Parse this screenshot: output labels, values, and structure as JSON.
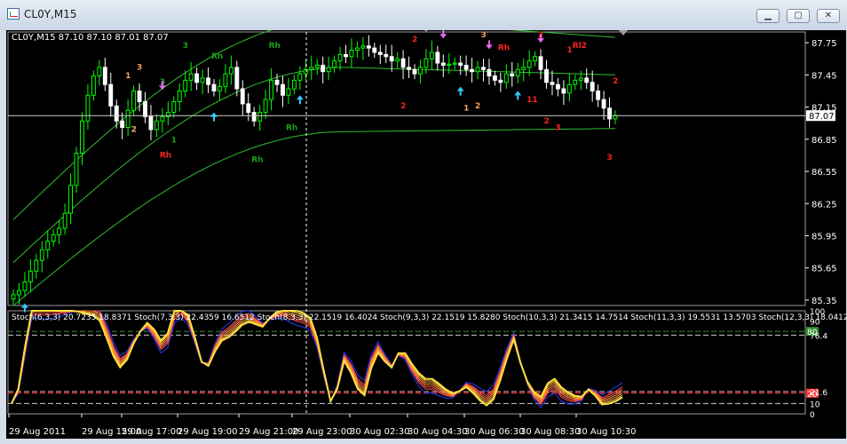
{
  "window": {
    "title": "CL0Y,M15",
    "min_label": "▁",
    "max_label": "▢",
    "close_label": "✕"
  },
  "chart_data": [
    {
      "type": "candlestick",
      "symbol": "CL0Y",
      "timeframe": "M15",
      "info_label": "CL0Y,M15  87.10 87.10 87.01 87.07",
      "ohlc": {
        "open": 87.1,
        "high": 87.1,
        "low": 87.01,
        "close": 87.07
      },
      "current_price": 87.07,
      "current_price_label": "87.07",
      "y_ticks": [
        85.35,
        85.65,
        85.95,
        86.25,
        86.55,
        86.85,
        87.15,
        87.45,
        87.75
      ],
      "y_tick_labels": [
        "85.35",
        "85.65",
        "85.95",
        "86.25",
        "86.55",
        "86.85",
        "87.15",
        "87.45",
        "87.75"
      ],
      "ylim": [
        85.3,
        87.85
      ],
      "close_series": [
        85.4,
        85.44,
        85.52,
        85.62,
        85.72,
        85.82,
        85.9,
        85.96,
        86.02,
        86.16,
        86.42,
        86.72,
        87.02,
        87.26,
        87.44,
        87.52,
        87.36,
        87.16,
        87.02,
        86.96,
        87.12,
        87.3,
        87.2,
        87.06,
        86.94,
        87.02,
        87.06,
        87.1,
        87.2,
        87.3,
        87.4,
        87.46,
        87.38,
        87.42,
        87.36,
        87.3,
        87.34,
        87.46,
        87.52,
        87.32,
        87.18,
        87.1,
        87.02,
        87.1,
        87.22,
        87.4,
        87.36,
        87.26,
        87.32,
        87.4,
        87.46,
        87.5,
        87.52,
        87.54,
        87.48,
        87.52,
        87.58,
        87.64,
        87.62,
        87.68,
        87.7,
        87.72,
        87.7,
        87.66,
        87.64,
        87.62,
        87.58,
        87.6,
        87.52,
        87.5,
        87.46,
        87.52,
        87.6,
        87.66,
        87.56,
        87.54,
        87.55,
        87.56,
        87.54,
        87.5,
        87.48,
        87.52,
        87.5,
        87.44,
        87.4,
        87.38,
        87.46,
        87.44,
        87.5,
        87.52,
        87.58,
        87.62,
        87.5,
        87.38,
        87.36,
        87.32,
        87.28,
        87.36,
        87.4,
        87.42,
        87.38,
        87.3,
        87.22,
        87.14,
        87.04,
        87.07
      ],
      "bands": {
        "upper_start": 86.1,
        "upper_peak": 87.98,
        "upper_end": 87.8,
        "middle_start": 85.7,
        "middle_peak": 87.52,
        "middle_end": 87.45,
        "lower_start": 85.3,
        "lower_peak": 86.92,
        "lower_end": 86.95
      },
      "annotations": [
        {
          "text": "1",
          "color": "#f4a460"
        },
        {
          "text": "2",
          "color": "#1aa01a"
        },
        {
          "text": "3",
          "color": "#f4a460"
        },
        {
          "text": "2",
          "color": "#f4a460"
        },
        {
          "text": "3",
          "color": "#1aa01a"
        },
        {
          "text": "1",
          "color": "#1aa01a"
        },
        {
          "text": "3",
          "color": "#1aa01a"
        },
        {
          "text": "Rh",
          "color": "#ff2222"
        },
        {
          "text": "Rh",
          "color": "#1aa01a"
        },
        {
          "text": "Rh",
          "color": "#1aa01a"
        },
        {
          "text": "Rh",
          "color": "#1aa01a"
        },
        {
          "text": "Rh",
          "color": "#1aa01a"
        },
        {
          "text": "1",
          "color": "#ff2222"
        },
        {
          "text": "2",
          "color": "#ff2222"
        },
        {
          "text": "2",
          "color": "#ff2222"
        },
        {
          "text": "1",
          "color": "#f4a460"
        },
        {
          "text": "3",
          "color": "#f4a460"
        },
        {
          "text": "2",
          "color": "#f4a460"
        },
        {
          "text": "Rh",
          "color": "#ff2222"
        },
        {
          "text": "11",
          "color": "#ff2222"
        },
        {
          "text": "2",
          "color": "#ff2222"
        },
        {
          "text": "3",
          "color": "#ff2222"
        },
        {
          "text": "1",
          "color": "#ff2222"
        },
        {
          "text": "2",
          "color": "#ff2222"
        },
        {
          "text": "Rl2",
          "color": "#ff2222"
        },
        {
          "text": "3",
          "color": "#ff2222"
        },
        {
          "text": "2",
          "color": "#ff2222"
        }
      ],
      "arrows": [
        {
          "direction": "up",
          "color": "#33ccff"
        },
        {
          "direction": "up",
          "color": "#33ccff"
        },
        {
          "direction": "up",
          "color": "#33ccff"
        },
        {
          "direction": "up",
          "color": "#33ccff"
        },
        {
          "direction": "up",
          "color": "#33ccff"
        },
        {
          "direction": "down",
          "color": "#ee66ee"
        },
        {
          "direction": "down",
          "color": "#ee66ee"
        },
        {
          "direction": "down",
          "color": "#ee66ee"
        },
        {
          "direction": "down",
          "color": "#ee66ee"
        },
        {
          "direction": "down",
          "color": "#ee66ee"
        },
        {
          "direction": "down",
          "color": "#ee66ee"
        }
      ],
      "colors": {
        "bull": "#00ff00",
        "bear": "#ffffff",
        "bands": "#2fbf2f",
        "axis_text": "#ffffff"
      }
    },
    {
      "type": "line",
      "title": "Stoch(6,3,3) 20.7235 18.8371  Stoch(7,3,3) 22.4359 16.6512  Stoch(8,3,3) 22.1519 16.4024  Stoch(9,3,3) 22.1519 15.8280  Stoch(10,3,3) 21.3415 14.7514  Stoch(11,3,3) 19.5531 13.5703  Stoch(12,3,3) 18.0412 12.83",
      "ylim": [
        0,
        100
      ],
      "y_ticks": [
        0,
        10,
        21.6,
        76.4,
        90,
        100
      ],
      "y_tick_labels": [
        "0",
        "10",
        "21.6",
        "76.4",
        "90",
        "100"
      ],
      "levels": [
        {
          "value": 80,
          "label": "80",
          "color": "#2f8f2f"
        },
        {
          "value": 20,
          "label": "20",
          "color": "#ff3333"
        },
        {
          "value": 76.4,
          "color": "#cccccc"
        },
        {
          "value": 21.6,
          "color": "#ffaaaa"
        },
        {
          "value": 10,
          "color": "#cccccc"
        }
      ],
      "stoch_series": [
        10,
        22,
        62,
        100,
        100,
        100,
        100,
        100,
        100,
        100,
        100,
        100,
        100,
        96,
        80,
        62,
        50,
        56,
        70,
        80,
        86,
        78,
        66,
        72,
        96,
        100,
        92,
        72,
        50,
        48,
        64,
        76,
        80,
        86,
        92,
        94,
        90,
        86,
        92,
        96,
        98,
        96,
        94,
        92,
        88,
        70,
        40,
        12,
        26,
        55,
        45,
        30,
        24,
        50,
        64,
        54,
        46,
        58,
        56,
        44,
        34,
        28,
        28,
        24,
        20,
        18,
        22,
        28,
        24,
        18,
        14,
        20,
        38,
        58,
        75,
        50,
        30,
        18,
        12,
        24,
        28,
        20,
        16,
        14,
        15,
        24,
        20,
        13,
        15,
        18,
        22
      ]
    }
  ],
  "x_axis": {
    "tick_labels": [
      "29 Aug 2011",
      "29 Aug 15:00",
      "29 Aug 17:00",
      "29 Aug 19:00",
      "29 Aug 21:00",
      "29 Aug 23:00",
      "30 Aug 02:30",
      "30 Aug 04:30",
      "30 Aug 06:30",
      "30 Aug 08:30",
      "30 Aug 10:30"
    ]
  }
}
